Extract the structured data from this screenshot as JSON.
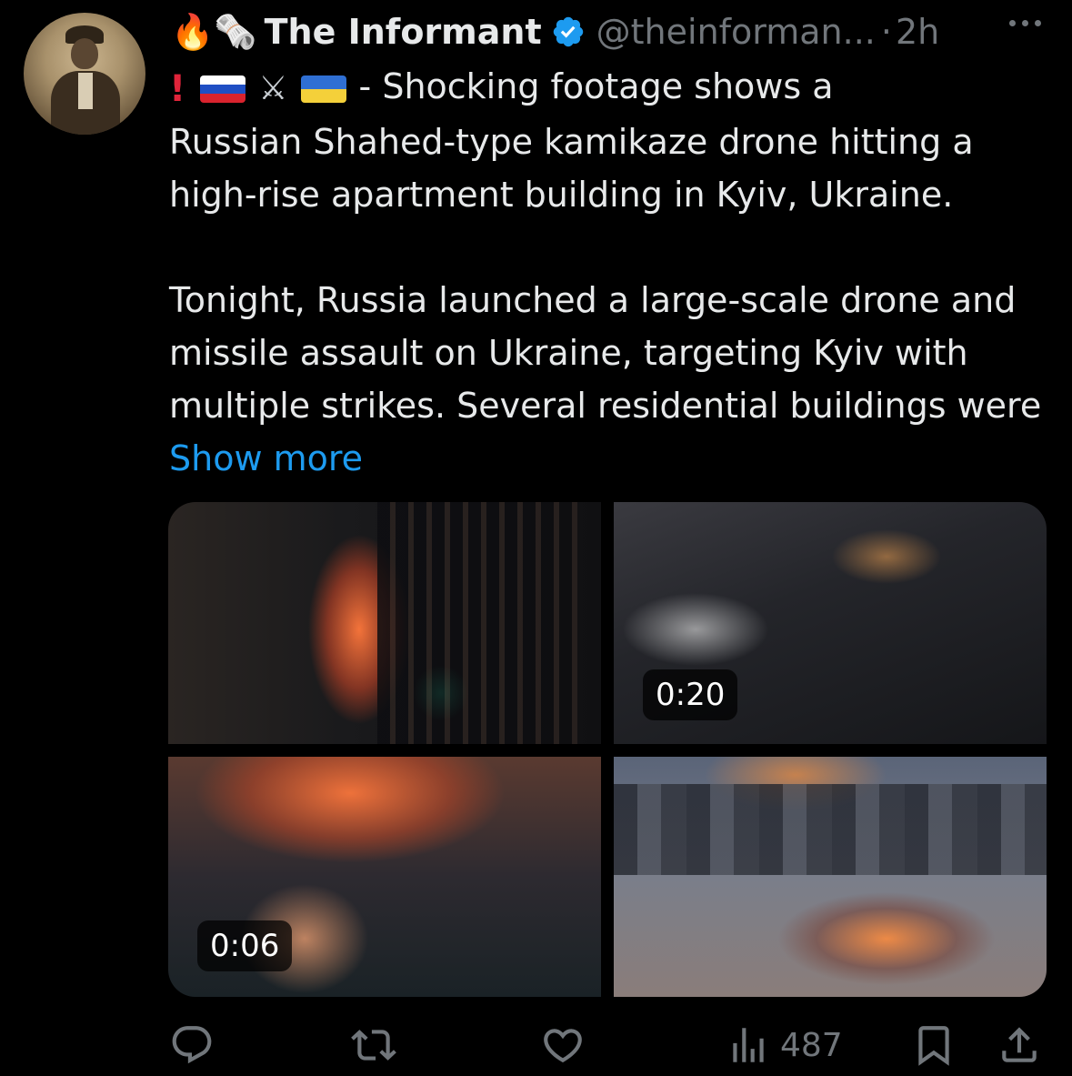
{
  "author": {
    "emoji_prefix": "🔥🗞️",
    "name": "The Informant",
    "handle": "@theinforman...",
    "separator": "·",
    "time": "2h"
  },
  "tweet": {
    "first_line": "- Shocking footage shows a",
    "para1": "Russian Shahed-type kamikaze drone hitting a high-rise apartment building in Kyiv, Ukraine.",
    "para2": "Tonight, Russia launched a large-scale drone and missile assault on Ukraine, targeting Kyiv with multiple strikes. Several residential buildings were",
    "show_more": "Show more"
  },
  "media": {
    "video1_duration": "0:20",
    "video2_duration": "0:06"
  },
  "actions": {
    "views": "487"
  },
  "colors": {
    "link": "#1d9bf0",
    "muted": "#71767b",
    "text": "#e7e9ea",
    "background": "#000000"
  }
}
